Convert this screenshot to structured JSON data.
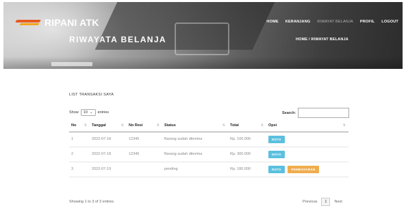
{
  "brand": {
    "name": "RIPANI ATK"
  },
  "nav": {
    "items": [
      "HOME",
      "KERANJANG",
      "RIWAYAT BELANJA",
      "PROFIL",
      "LOGOUT"
    ],
    "active": 2
  },
  "hero": {
    "title": "RIWAYATA BELANJA",
    "breadcrumb": "HOME / RIWAYAT BELANJA"
  },
  "section": {
    "title": "LIST TRANSAKSI SAYA"
  },
  "controls": {
    "show_label": "Show",
    "entries_value": "10",
    "entries_label": "entries",
    "search_label": "Search:",
    "search_value": ""
  },
  "table": {
    "headers": [
      "No",
      "Tanggal",
      "No Resi",
      "Status",
      "Total",
      "Opsi"
    ],
    "rows": [
      {
        "no": "1",
        "tanggal": "2022-07-18",
        "resi": "12345",
        "status": "Barang sudah diterima",
        "total": "Rp. 100.000",
        "buttons": [
          "NOTA"
        ]
      },
      {
        "no": "2",
        "tanggal": "2022-07-18",
        "resi": "12345",
        "status": "Barang sudah diterima",
        "total": "Rp. 300.000",
        "buttons": [
          "NOTA"
        ]
      },
      {
        "no": "3",
        "tanggal": "2022-07-19",
        "resi": "",
        "status": "pending",
        "total": "Rp. 180.000",
        "buttons": [
          "NOTA",
          "PEMBAYARAN"
        ]
      }
    ]
  },
  "footer": {
    "info": "Showing 1 to 3 of 3 entries",
    "previous": "Previous",
    "page": "1",
    "next": "Next"
  },
  "colors": {
    "nota": "#5bc0de",
    "pembayaran": "#f0ad4e",
    "logo_primary": "#e65a1e",
    "logo_secondary": "#f3a51c"
  }
}
